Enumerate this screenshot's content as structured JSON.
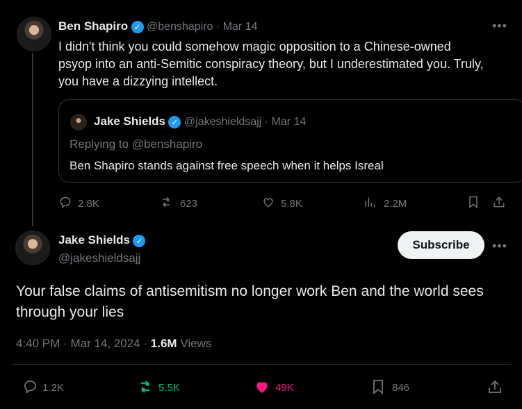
{
  "tweet1": {
    "author_name": "Ben Shapiro",
    "handle": "@benshapiro",
    "date": "Mar 14",
    "text_line1": "I didn't think you could somehow magic opposition to a Chinese-owned",
    "text_line2": "psyop into an anti-Semitic conspiracy theory, but I underestimated you. Truly,",
    "text_line3": "you have a dizzying intellect.",
    "replies": "2.8K",
    "retweets": "623",
    "likes": "5.8K",
    "views": "2.2M"
  },
  "quoted": {
    "author_name": "Jake Shields",
    "handle": "@jakeshieldsajj",
    "date": "Mar 14",
    "replying_to": "Replying to @benshapiro",
    "text": "Ben Shapiro stands against free speech when it helps Isreal"
  },
  "tweet2": {
    "author_name": "Jake Shields",
    "handle": "@jakeshieldsajj",
    "subscribe_label": "Subscribe",
    "text_line1": "Your false claims of antisemitism no longer work Ben and the world sees",
    "text_line2": "through your lies",
    "time": "4:40 PM",
    "date": "Mar 14, 2024",
    "views_count": "1.6M",
    "views_label": "Views",
    "replies": "1.2K",
    "retweets": "5.5K",
    "likes": "49K",
    "bookmarks": "846"
  },
  "separators": {
    "dot": "·"
  },
  "icons": {
    "more": "more-icon",
    "verified": "verified-badge-icon",
    "reply": "reply-icon",
    "retweet": "retweet-icon",
    "like": "heart-icon",
    "views": "views-icon",
    "bookmark": "bookmark-icon",
    "share": "share-icon"
  },
  "colors": {
    "verified": "#1d9bf0",
    "retweet_active": "#00ba7c",
    "like_active": "#f91880",
    "muted": "#71767b",
    "text": "#e7e9ea"
  }
}
